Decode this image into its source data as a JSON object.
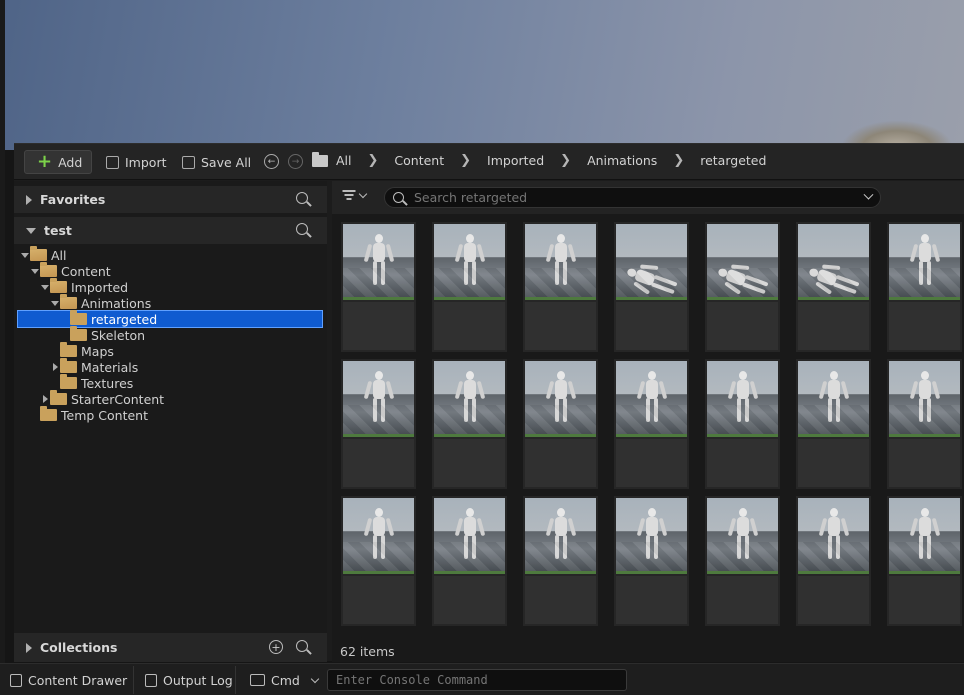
{
  "toolbar": {
    "add_label": "Add",
    "import_label": "Import",
    "saveall_label": "Save All",
    "breadcrumb": [
      "All",
      "Content",
      "Imported",
      "Animations",
      "retargeted"
    ]
  },
  "left": {
    "favorites_label": "Favorites",
    "test_label": "test",
    "collections_label": "Collections",
    "tree": [
      {
        "label": "All",
        "depth": 0,
        "expanded": true,
        "selected": false
      },
      {
        "label": "Content",
        "depth": 1,
        "expanded": true,
        "selected": false
      },
      {
        "label": "Imported",
        "depth": 2,
        "expanded": true,
        "selected": false
      },
      {
        "label": "Animations",
        "depth": 3,
        "expanded": true,
        "selected": false
      },
      {
        "label": "retargeted",
        "depth": 4,
        "expanded": null,
        "selected": true
      },
      {
        "label": "Skeleton",
        "depth": 4,
        "expanded": null,
        "selected": false
      },
      {
        "label": "Maps",
        "depth": 3,
        "expanded": null,
        "selected": false
      },
      {
        "label": "Materials",
        "depth": 3,
        "expanded": false,
        "selected": false
      },
      {
        "label": "Textures",
        "depth": 3,
        "expanded": null,
        "selected": false
      },
      {
        "label": "StarterContent",
        "depth": 2,
        "expanded": false,
        "selected": false
      },
      {
        "label": "Temp Content",
        "depth": 1,
        "expanded": null,
        "selected": false
      }
    ]
  },
  "search": {
    "placeholder": "Search retargeted"
  },
  "grid": {
    "visible_rows": 3,
    "visible_cols": 7,
    "item_count": "62 items"
  },
  "statusbar": {
    "drawer_label": "Content Drawer",
    "output_label": "Output Log",
    "cmd_label": "Cmd",
    "console_placeholder": "Enter Console Command"
  },
  "colors": {
    "selection": "#0f5bd0",
    "folder": "#c9a15c",
    "add_plus": "#7cd24a",
    "thumb_strip": "#4e7a3e"
  }
}
